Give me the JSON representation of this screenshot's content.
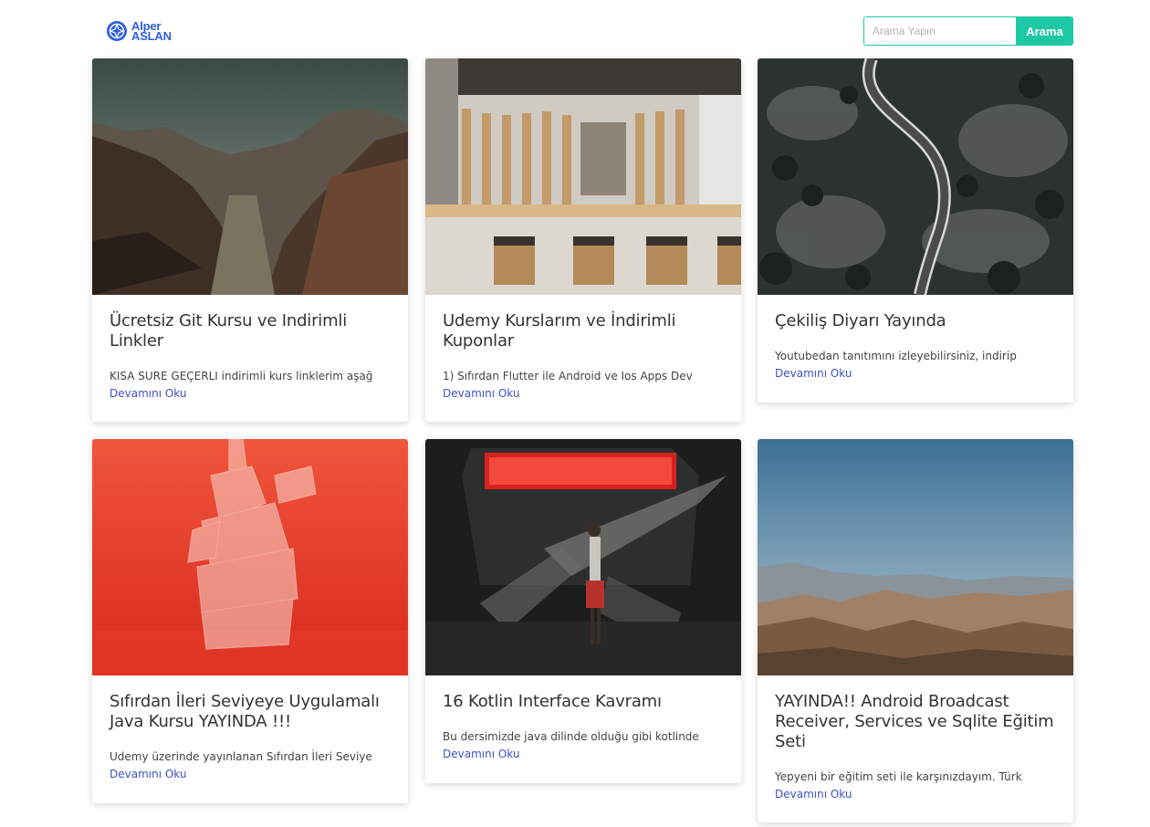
{
  "header": {
    "logo": {
      "line1": "Alper",
      "line2": "ASLAN"
    },
    "search": {
      "placeholder": "Arama Yapın",
      "button_label": "Arama"
    }
  },
  "colors": {
    "accent": "#1fc8a4",
    "link": "#3c52c6",
    "logo": "#2f5fe0"
  },
  "posts": [
    {
      "title": "Ücretsiz Git Kursu ve Indirimli Linkler",
      "excerpt": "KISA SURE GEÇERLI indirimli kurs linklerim aşağ",
      "read_more": "Devamını Oku",
      "image": "canyon-valley-photo"
    },
    {
      "title": "Udemy Kurslarım ve İndirimli Kuponlar",
      "excerpt": "1) Sıfırdan Flutter ile Android ve Ios Apps Dev",
      "read_more": "Devamını Oku",
      "image": "wooden-interior-photo"
    },
    {
      "title": "Çekiliş Diyarı Yayında",
      "excerpt": "Youtubedan tanıtımını izleyebilirsiniz, indirip",
      "read_more": "Devamını Oku",
      "image": "snowy-forest-road-photo"
    },
    {
      "title": "Sıfırdan İleri Seviyeye Uygulamalı Java Kursu YAYINDA !!!",
      "excerpt": "Udemy üzerinde yayınlanan Sıfırdan İleri Seviye",
      "read_more": "Devamını Oku",
      "image": "shattered-glass-red-photo"
    },
    {
      "title": "16 Kotlin Interface Kavramı",
      "excerpt": "Bu dersimizde java dilinde olduğu gibi kotlinde",
      "read_more": "Devamını Oku",
      "image": "girl-and-red-light-photo"
    },
    {
      "title": "YAYINDA!! Android Broadcast Receiver, Services ve Sqlite Eğitim Seti",
      "excerpt": "Yepyeni bir eğitim seti ile karşınızdayım. Türk",
      "read_more": "Devamını Oku",
      "image": "desert-mountains-photo"
    }
  ]
}
